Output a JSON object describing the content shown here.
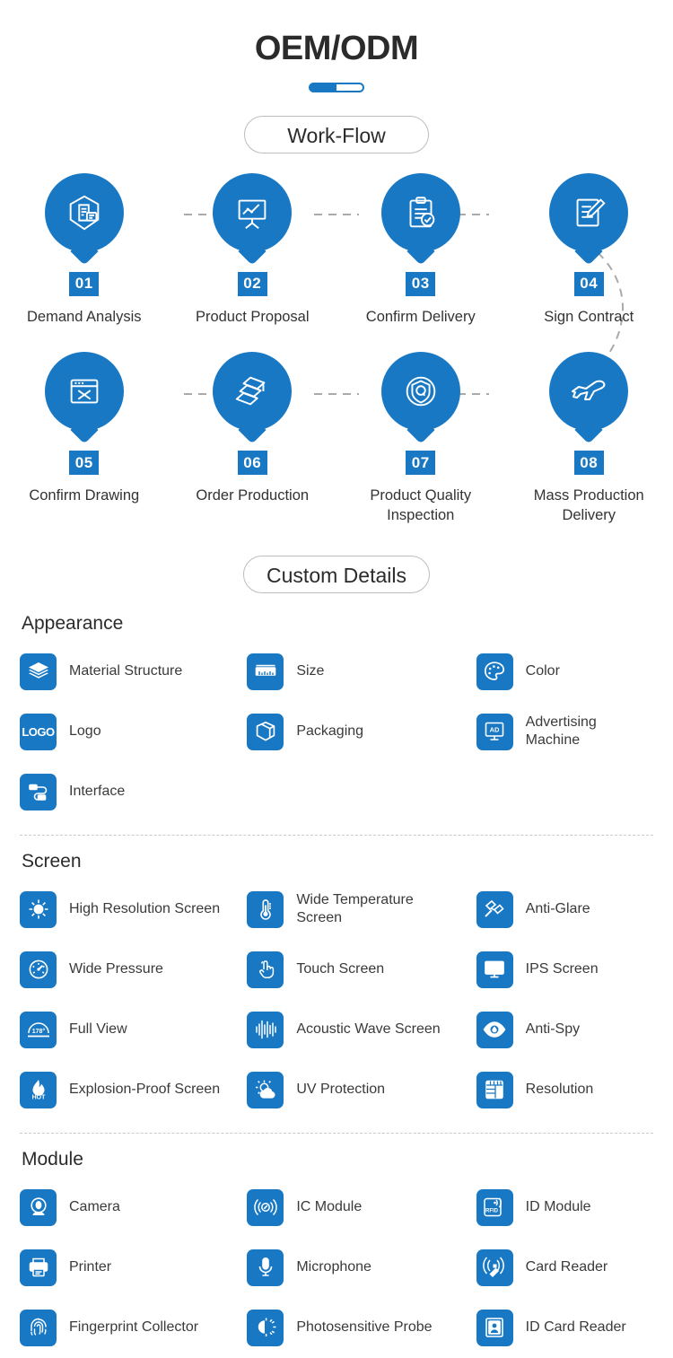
{
  "header": {
    "title": "OEM/ODM",
    "divider_colors": {
      "fill": "#1878c4",
      "track": "#ffffff"
    },
    "workflow_badge": "Work-Flow",
    "details_badge": "Custom Details"
  },
  "theme": {
    "accent": "#1878c4",
    "text": "#333333",
    "divider": "#c9c9c9"
  },
  "workflow": {
    "steps": [
      {
        "num": "01",
        "label": "Demand Analysis",
        "icon": "document-shield-icon"
      },
      {
        "num": "02",
        "label": "Product Proposal",
        "icon": "presentation-chart-icon"
      },
      {
        "num": "03",
        "label": "Confirm Delivery",
        "icon": "clipboard-check-icon"
      },
      {
        "num": "04",
        "label": "Sign Contract",
        "icon": "contract-pen-icon"
      },
      {
        "num": "05",
        "label": "Confirm Drawing",
        "icon": "browser-tools-icon"
      },
      {
        "num": "06",
        "label": "Order Production",
        "icon": "stacked-sheets-icon"
      },
      {
        "num": "07",
        "label": "Product Quality Inspection",
        "icon": "quality-shield-icon"
      },
      {
        "num": "08",
        "label": "Mass Production Delivery",
        "icon": "airplane-icon"
      }
    ]
  },
  "details": {
    "sections": [
      {
        "title": "Appearance",
        "items": [
          {
            "label": "Material Structure",
            "icon": "layers-icon"
          },
          {
            "label": "Size",
            "icon": "ruler-icon"
          },
          {
            "label": "Color",
            "icon": "palette-icon"
          },
          {
            "label": "Logo",
            "icon": "logo-text-icon",
            "tag": "LOGO"
          },
          {
            "label": "Packaging",
            "icon": "box-icon"
          },
          {
            "label": "Advertising Machine",
            "icon": "ad-display-icon",
            "tag": "AD"
          },
          {
            "label": "Interface",
            "icon": "usb-cable-icon"
          }
        ]
      },
      {
        "title": "Screen",
        "items": [
          {
            "label": "High Resolution Screen",
            "icon": "brightness-icon"
          },
          {
            "label": "Wide Temperature Screen",
            "icon": "thermometer-icon"
          },
          {
            "label": "Anti-Glare",
            "icon": "glare-glasses-icon"
          },
          {
            "label": "Wide Pressure",
            "icon": "gauge-icon"
          },
          {
            "label": "Touch Screen",
            "icon": "touch-hand-icon"
          },
          {
            "label": "IPS Screen",
            "icon": "monitor-icon"
          },
          {
            "label": "Full View",
            "icon": "viewing-angle-icon",
            "tag": "178°"
          },
          {
            "label": "Acoustic Wave Screen",
            "icon": "sound-wave-icon"
          },
          {
            "label": "Anti-Spy",
            "icon": "eye-icon"
          },
          {
            "label": "Explosion-Proof Screen",
            "icon": "flame-hot-icon",
            "tag": "HOT"
          },
          {
            "label": "UV Protection",
            "icon": "uv-sun-cloud-icon"
          },
          {
            "label": "Resolution",
            "icon": "resolution-grid-icon"
          }
        ]
      },
      {
        "title": "Module",
        "items": [
          {
            "label": "Camera",
            "icon": "camera-icon"
          },
          {
            "label": "IC Module",
            "icon": "nfc-signal-icon"
          },
          {
            "label": "ID Module",
            "icon": "rfid-card-icon",
            "tag": "RFID"
          },
          {
            "label": "Printer",
            "icon": "printer-icon"
          },
          {
            "label": "Microphone",
            "icon": "microphone-icon"
          },
          {
            "label": "Card Reader",
            "icon": "card-reader-icon"
          },
          {
            "label": "Fingerprint Collector",
            "icon": "fingerprint-icon"
          },
          {
            "label": "Photosensitive Probe",
            "icon": "photosensor-icon"
          },
          {
            "label": "ID Card Reader",
            "icon": "id-card-person-icon"
          }
        ]
      }
    ]
  }
}
